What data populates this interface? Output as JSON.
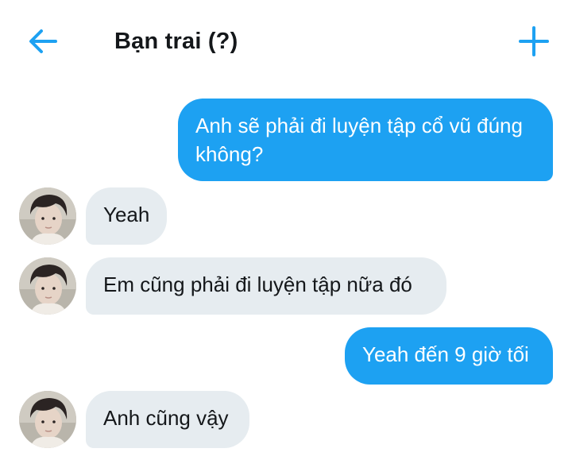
{
  "header": {
    "title": "Bạn trai (?)",
    "back_icon": "arrow-left-icon",
    "add_icon": "plus-icon",
    "accent_color": "#1da1f2"
  },
  "messages": [
    {
      "direction": "outgoing",
      "text": "Anh sẽ phải đi luyện tập cổ vũ đúng không?"
    },
    {
      "direction": "incoming",
      "text": "Yeah"
    },
    {
      "direction": "incoming",
      "text": "Em cũng phải đi luyện tập nữa đó"
    },
    {
      "direction": "outgoing",
      "text": "Yeah đến 9 giờ tối"
    },
    {
      "direction": "incoming",
      "text": "Anh cũng vậy"
    }
  ],
  "colors": {
    "outgoing_bubble": "#1da1f2",
    "incoming_bubble": "#e6ecf0",
    "text_dark": "#14171a"
  }
}
